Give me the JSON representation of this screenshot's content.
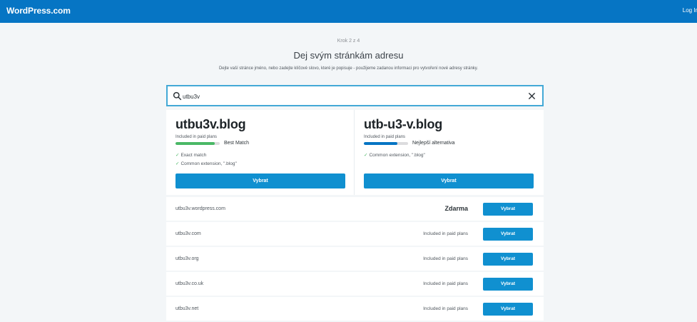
{
  "header": {
    "brand": "WordPress.com",
    "login": "Log In"
  },
  "step": "Krok 2 z 4",
  "title": "Dej svým stránkám adresu",
  "subtitle": "Dejte vaší stránce jméno, nebo zadejte klíčové slovo, které je popisuje - použijeme zadanou informaci pro vytvoření nové adresy stránky.",
  "search": {
    "value": "utbu3v",
    "search_icon": "search-icon",
    "clear_icon": "close-icon"
  },
  "featured": [
    {
      "domain": "utbu3v.blog",
      "paid_note": "Included in paid plans",
      "match_label": "Best Match",
      "match_level": 0.88,
      "meter_color": "#4ab866",
      "checks": [
        "Exact match",
        "Common extension, \".blog\""
      ],
      "button": "Vybrat"
    },
    {
      "domain": "utb-u3-v.blog",
      "paid_note": "Included in paid plans",
      "match_label": "Nejlepší alternativa",
      "match_level": 0.75,
      "meter_color": "#0675c4",
      "checks": [
        "Common extension, \".blog\""
      ],
      "button": "Vybrat"
    }
  ],
  "results": [
    {
      "domain": "utbu3v.wordpress.com",
      "price": "Zdarma",
      "free": true,
      "button": "Vybrat"
    },
    {
      "domain": "utbu3v.com",
      "price": "Included in paid plans",
      "free": false,
      "button": "Vybrat"
    },
    {
      "domain": "utbu3v.org",
      "price": "Included in paid plans",
      "free": false,
      "button": "Vybrat"
    },
    {
      "domain": "utbu3v.co.uk",
      "price": "Included in paid plans",
      "free": false,
      "button": "Vybrat"
    },
    {
      "domain": "utbu3v.net",
      "price": "Included in paid plans",
      "free": false,
      "button": "Vybrat"
    }
  ],
  "colors": {
    "header_bg": "#0675c4",
    "button_bg": "#1090d0",
    "search_border": "#43a9d6",
    "check": "#4ab866"
  }
}
